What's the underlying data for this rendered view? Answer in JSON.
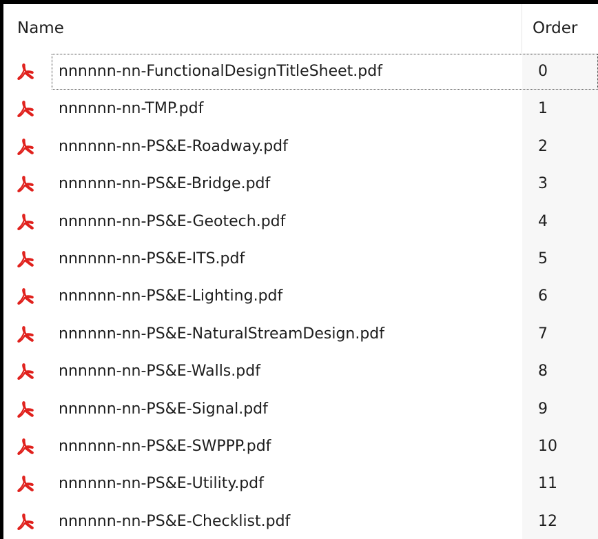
{
  "columns": {
    "name": "Name",
    "order": "Order"
  },
  "rows": [
    {
      "name": "nnnnnn-nn-FunctionalDesignTitleSheet.pdf",
      "order": "0",
      "focused": true
    },
    {
      "name": "nnnnnn-nn-TMP.pdf",
      "order": "1"
    },
    {
      "name": "nnnnnn-nn-PS&E-Roadway.pdf",
      "order": "2"
    },
    {
      "name": "nnnnnn-nn-PS&E-Bridge.pdf",
      "order": "3"
    },
    {
      "name": "nnnnnn-nn-PS&E-Geotech.pdf",
      "order": "4"
    },
    {
      "name": "nnnnnn-nn-PS&E-ITS.pdf",
      "order": "5"
    },
    {
      "name": "nnnnnn-nn-PS&E-Lighting.pdf",
      "order": "6"
    },
    {
      "name": "nnnnnn-nn-PS&E-NaturalStreamDesign.pdf",
      "order": "7"
    },
    {
      "name": "nnnnnn-nn-PS&E-Walls.pdf",
      "order": "8"
    },
    {
      "name": "nnnnnn-nn-PS&E-Signal.pdf",
      "order": "9"
    },
    {
      "name": "nnnnnn-nn-PS&E-SWPPP.pdf",
      "order": "10"
    },
    {
      "name": "nnnnnn-nn-PS&E-Utility.pdf",
      "order": "11"
    },
    {
      "name": "nnnnnn-nn-PS&E-Checklist.pdf",
      "order": "12"
    }
  ],
  "icon": {
    "name": "pdf-file-icon",
    "color": "#e0201c"
  }
}
